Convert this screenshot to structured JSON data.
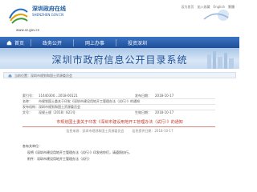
{
  "header": {
    "site_name": "深圳政府在线",
    "site_name_en": "SHENZHEN.GOV.CN",
    "url": "www.sz.gov.cn",
    "top_links": [
      "设为首页",
      "加入收藏",
      "English",
      "繁體"
    ]
  },
  "nav": {
    "home_label": "首页",
    "items": [
      "政务公开",
      "网上办事",
      "投资深圳"
    ]
  },
  "banner": {
    "title": "深圳市政府信息公开目录系统"
  },
  "breadcrumb": {
    "text": "当前位置：深圳市规划和国土资源委员会"
  },
  "info": {
    "row1": {
      "label_a": "索引号：",
      "value_a": "11440300…2018-00121",
      "label_b": "发布日期：",
      "value_b": "2018-10-17"
    },
    "row2": {
      "label_a": "名称：",
      "value_a": "市规划国土委关于印发《深圳市建设用地开工管理办法（试行）》的通知",
      "label_b": "",
      "value_b": ""
    },
    "row3": {
      "label_a": "发布机构：",
      "value_a": "深圳市规划和国土资源委员会",
      "label_b": "",
      "value_b": ""
    },
    "row4": {
      "label_a": "文号：",
      "value_a": "深规土规〔2018〕821号",
      "label_b": "生效日期：",
      "value_b": "2018-10-17"
    }
  },
  "document": {
    "title": "市规划国土委关于印发《深圳市建设用地开工管理办法（试行）》的通知",
    "meta_source": "信息来源：深圳市规划和国土资源委员会",
    "meta_date": "信息提供日期：2018-10-17",
    "body_lines": [
      "各有关单位：",
      "现将《深圳市建设用地开工管理办法（试行）》印发给你们，请遵照执行。",
      "附件：深圳市建设用地开工管理办法（试行）"
    ]
  },
  "colors": {
    "nav": "#1f4f98",
    "banner_text": "#1e4f99",
    "doc_title": "#c0392b"
  }
}
